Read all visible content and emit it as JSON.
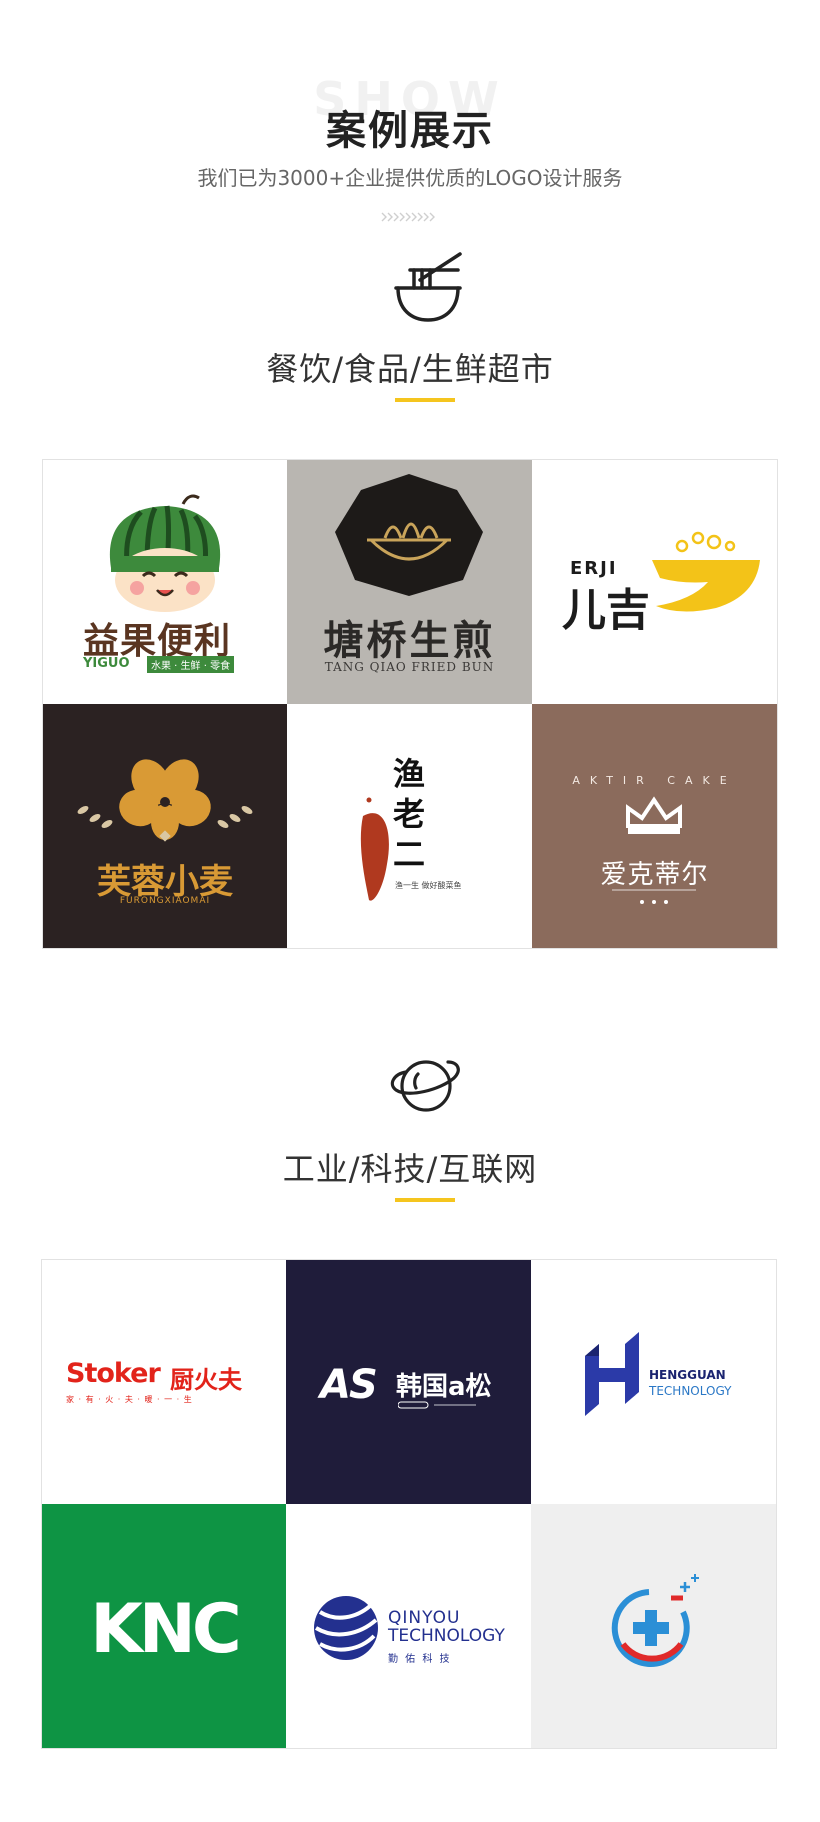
{
  "header": {
    "bg_word": "SHOW",
    "title": "案例展示",
    "subtitle": "我们已为3000+企业提供优质的LOGO设计服务",
    "divider_icon": "chevron-pattern-icon"
  },
  "sections": [
    {
      "icon": "noodle-bowl-icon",
      "title": "餐饮/食品/生鲜超市",
      "logos": [
        {
          "name": "益果便利",
          "sub": "YIGUO",
          "tagline": "水果 · 生鲜 · 零食",
          "bg": "#ffffff"
        },
        {
          "name": "塘桥生煎",
          "sub": "TANG QIAO FRIED BUN",
          "bg": "#b9b6b1"
        },
        {
          "name": "儿吉",
          "sub": "ERJI",
          "bg": "#ffffff"
        },
        {
          "name": "芙蓉小麦",
          "sub": "FURONGXIAOMAI",
          "bg": "#2b2222"
        },
        {
          "name_lines": [
            "渔",
            "老",
            "二"
          ],
          "tagline": "渔一生 做好酸菜鱼",
          "bg": "#ffffff"
        },
        {
          "name": "爱克蒂尔",
          "sub": "AKTIR CAKE",
          "bg": "#8b6b5c"
        }
      ]
    },
    {
      "icon": "planet-icon",
      "title": "工业/科技/互联网",
      "logos": [
        {
          "name_en": "Stoker",
          "name": "厨火夫",
          "tagline": "家 · 有 · 火 · 夫 · 暖 · 一 · 生",
          "bg": "#ffffff"
        },
        {
          "name_en": "AS",
          "name": "韩国a松",
          "bg": "#1f1c3a"
        },
        {
          "name": "HENGGUAN",
          "sub": "TECHNOLOGY",
          "bg": "#ffffff"
        },
        {
          "name": "KNC",
          "bg": "#0e9444"
        },
        {
          "name": "QINYOU",
          "sub": "TECHNOLOGY",
          "tagline": "勤 佑 科 技",
          "bg": "#ffffff"
        },
        {
          "name": "",
          "bg": "#efefef"
        }
      ]
    }
  ],
  "colors": {
    "accent": "#f5c51e",
    "text_dark": "#222222",
    "text_mid": "#666666",
    "stoker_red": "#e2231a",
    "hengguan_blue": "#2b3aa8",
    "knc_green": "#0e9444"
  }
}
